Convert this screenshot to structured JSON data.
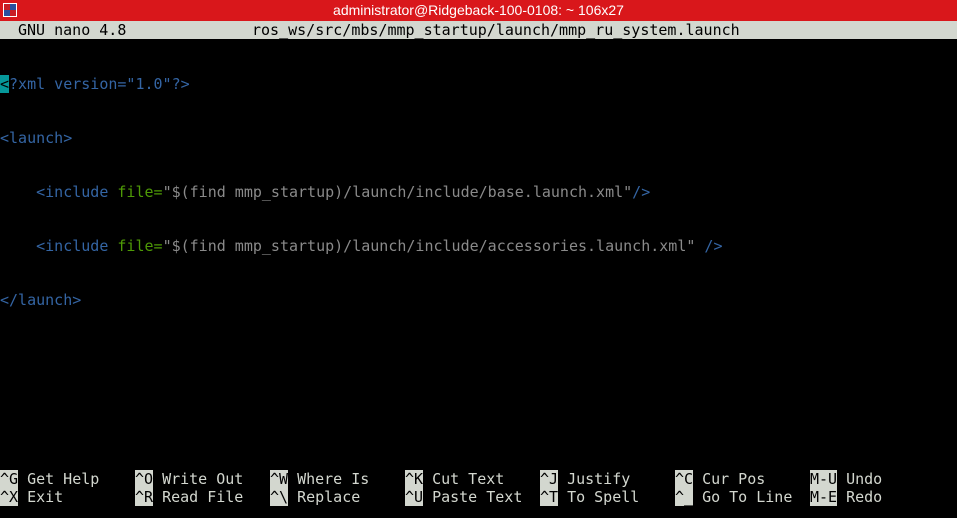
{
  "window": {
    "title": "administrator@Ridgeback-100-0108: ~ 106x27",
    "title_bg": "#d9171b"
  },
  "nano": {
    "version": "GNU nano 4.8",
    "filename": "ros_ws/src/mbs/mmp_startup/launch/mmp_ru_system.launch"
  },
  "file": {
    "line1": {
      "cursor_char": "<",
      "rest": "?xml version=\"1.0\"?>"
    },
    "line2": "<launch>",
    "line3": {
      "indent": "    ",
      "open": "<include",
      "attr": " file=",
      "value": "\"$(find mmp_startup)/launch/include/base.launch.xml\"",
      "close": "/>"
    },
    "line4": {
      "indent": "    ",
      "open": "<include",
      "attr": " file=",
      "value": "\"$(find mmp_startup)/launch/include/accessories.launch.xml\"",
      "close": " />"
    },
    "line5": "</launch>"
  },
  "shortcuts": [
    {
      "key": "^G",
      "label": "Get Help"
    },
    {
      "key": "^O",
      "label": "Write Out"
    },
    {
      "key": "^W",
      "label": "Where Is"
    },
    {
      "key": "^K",
      "label": "Cut Text"
    },
    {
      "key": "^J",
      "label": "Justify"
    },
    {
      "key": "^C",
      "label": "Cur Pos"
    },
    {
      "key": "M-U",
      "label": "Undo"
    },
    {
      "key": "^X",
      "label": "Exit"
    },
    {
      "key": "^R",
      "label": "Read File"
    },
    {
      "key": "^\\",
      "label": "Replace"
    },
    {
      "key": "^U",
      "label": "Paste Text"
    },
    {
      "key": "^T",
      "label": "To Spell"
    },
    {
      "key": "^_",
      "label": "Go To Line"
    },
    {
      "key": "M-E",
      "label": "Redo"
    }
  ],
  "colors": {
    "terminal_bg": "#000000",
    "header_bg": "#d3d7cf",
    "tag": "#3465a4",
    "attribute": "#4e9a06",
    "string": "#8a8a8a",
    "cursor": "#06989a"
  }
}
